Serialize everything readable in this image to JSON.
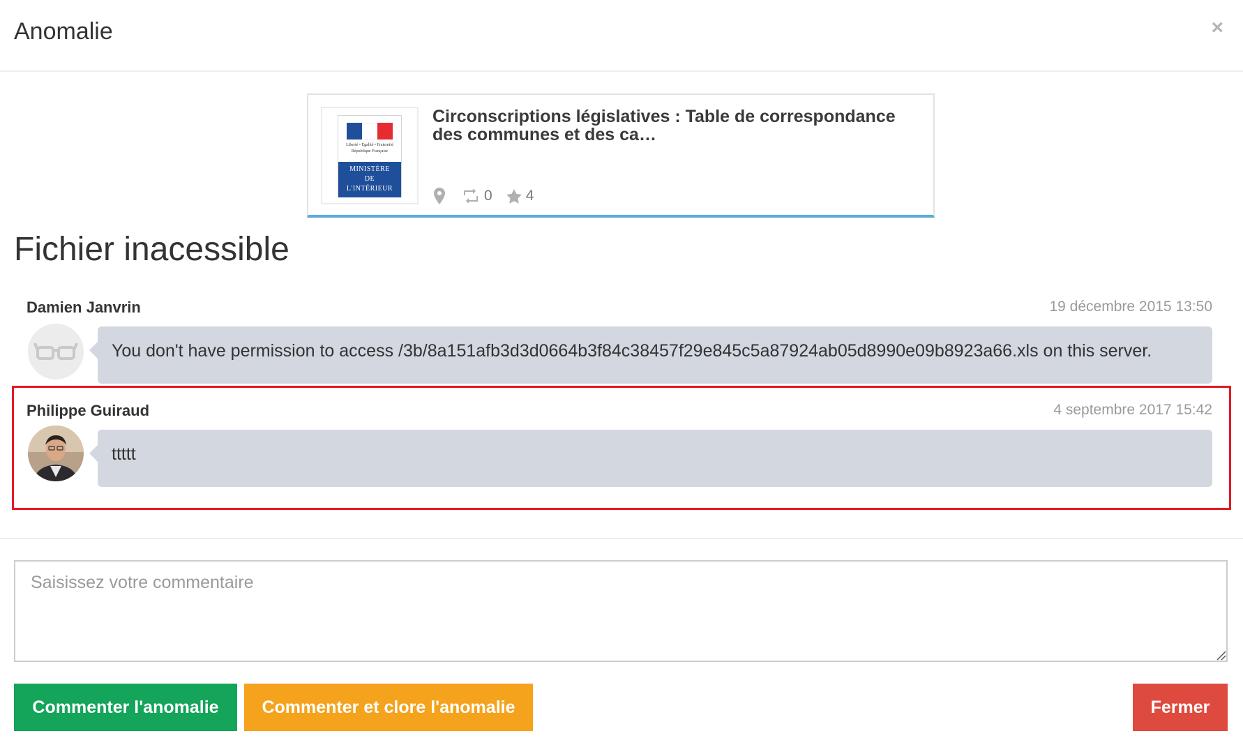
{
  "header": {
    "title": "Anomalie",
    "close_label": "×"
  },
  "dataset_card": {
    "title": "Circonscriptions législatives : Table de correspondance des communes et des ca…",
    "logo": {
      "motto": "Liberté • Égalité • Fraternité",
      "republic": "République Française",
      "line1": "MINISTÈRE",
      "line2": "DE",
      "line3": "L'INTÉRIEUR"
    },
    "reuses_count": "0",
    "stars_count": "4",
    "accent_color": "#5aabdc"
  },
  "issue": {
    "title": "Fichier inacessible"
  },
  "comments": [
    {
      "author": "Damien Janvrin",
      "date": "19 décembre 2015 13:50",
      "message": "You don't have permission to access /3b/8a151afb3d3d0664b3f84c38457f29e845c5a87924ab05d8990e09b8923a66.xls on this server.",
      "avatar_icon": "glasses-icon"
    },
    {
      "author": "Philippe Guiraud",
      "date": "4 septembre 2017 15:42",
      "message": "ttttt",
      "avatar_icon": "user-photo"
    }
  ],
  "form": {
    "placeholder": "Saisissez votre commentaire",
    "value": ""
  },
  "buttons": {
    "comment": "Commenter l'anomalie",
    "comment_close": "Commenter et clore l'anomalie",
    "close": "Fermer"
  },
  "colors": {
    "green": "#14a55a",
    "orange": "#f5a21c",
    "red": "#df4a3e",
    "highlight": "#e01b24",
    "bubble": "#d2d7e0"
  }
}
